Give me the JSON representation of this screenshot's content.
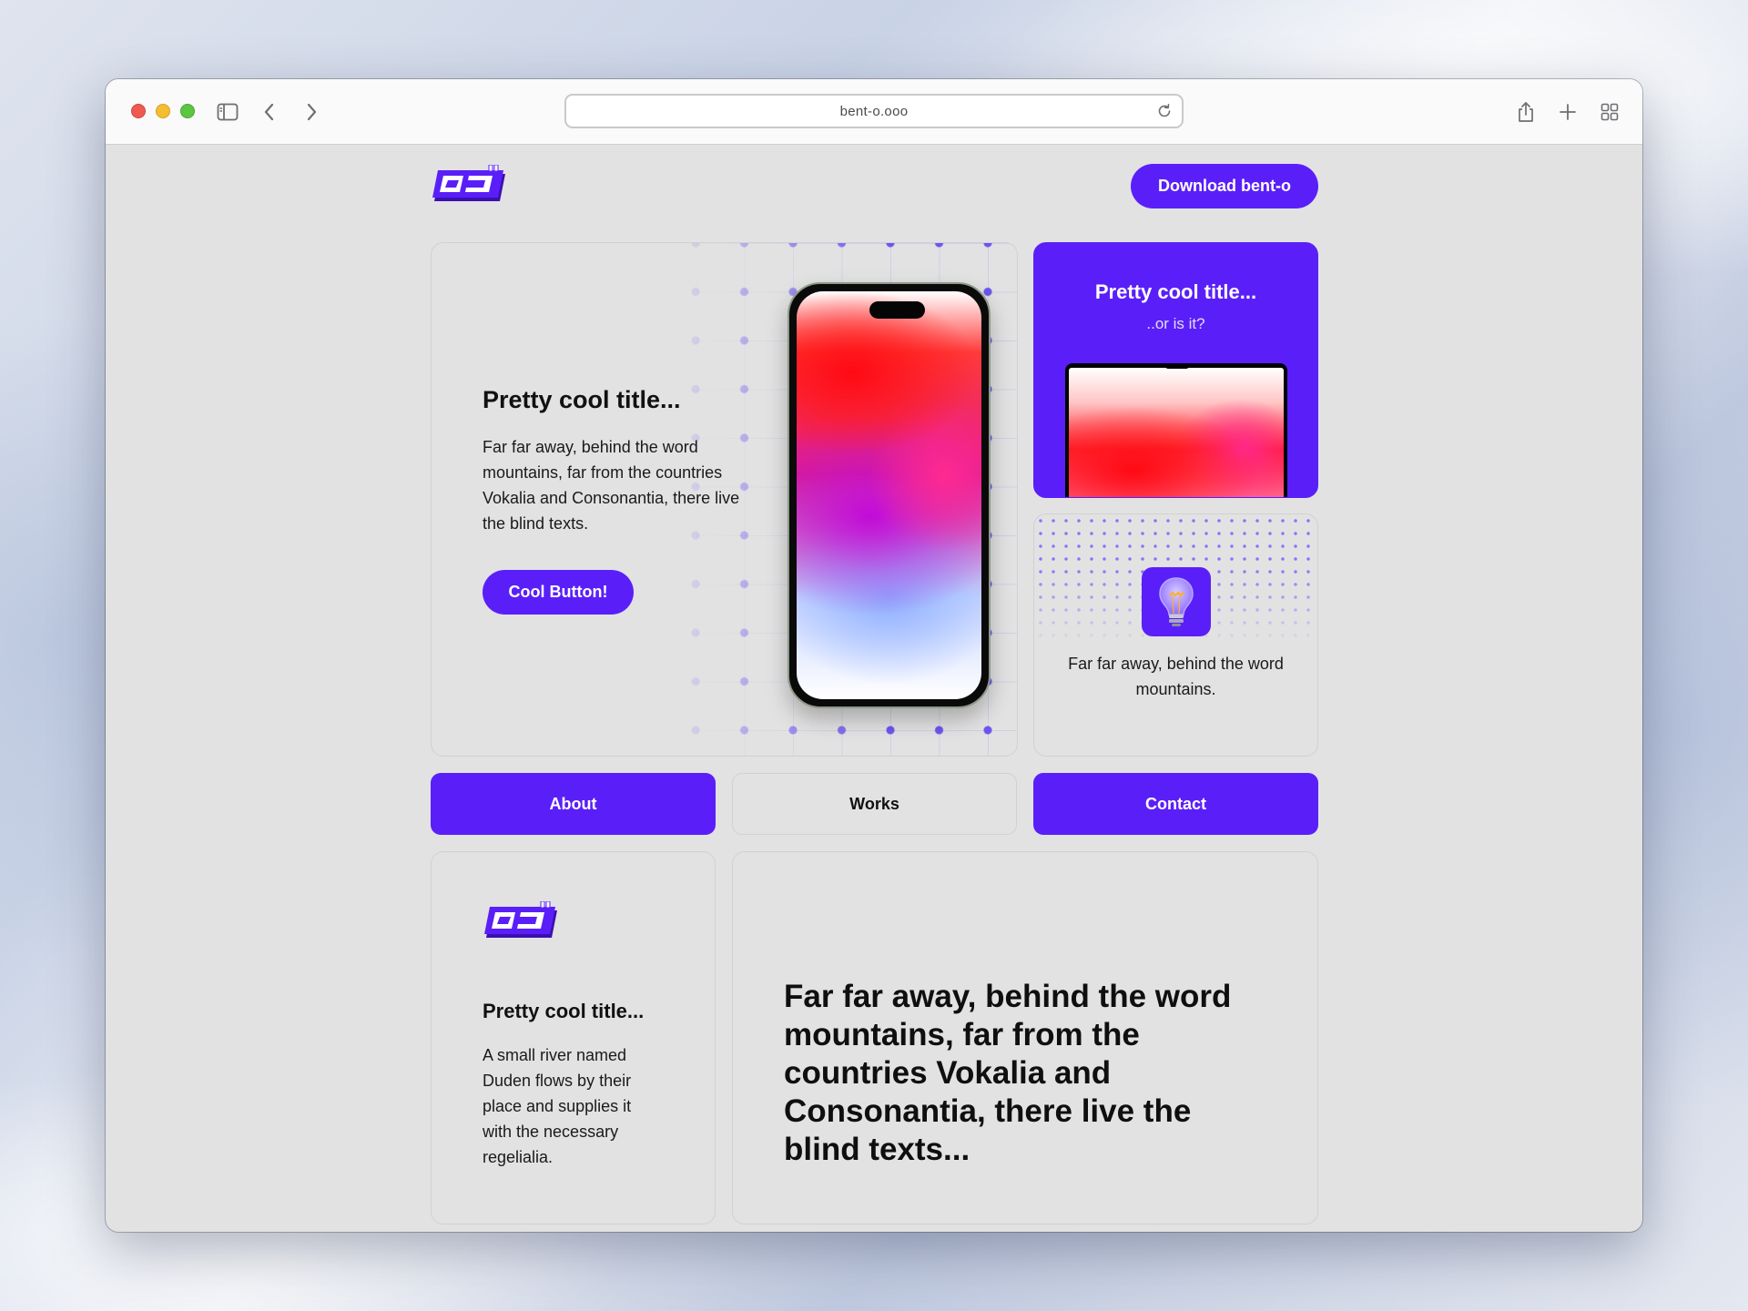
{
  "browser": {
    "url": "bent-o.ooo"
  },
  "header": {
    "download_label": "Download bent-o"
  },
  "hero": {
    "title": "Pretty cool title...",
    "text": "Far far away, behind the word mountains, far from the countries Vokalia and Consonantia, there live the blind texts.",
    "button_label": "Cool Button!"
  },
  "side_card_1": {
    "title": "Pretty cool title...",
    "subtitle": "..or is it?"
  },
  "side_card_2": {
    "text": "Far far away, behind the word mountains."
  },
  "nav": {
    "about": "About",
    "works": "Works",
    "contact": "Contact"
  },
  "bottom_left": {
    "title": "Pretty cool title...",
    "text": "A small river named Duden flows by their place and supplies it with the necessary regelialia."
  },
  "bottom_right": {
    "text": "Far far away, behind the word mountains, far from the countries Vokalia and Consonantia, there live the blind texts..."
  },
  "colors": {
    "accent": "#5a1ff8",
    "card_bg": "#e2e2e3"
  }
}
